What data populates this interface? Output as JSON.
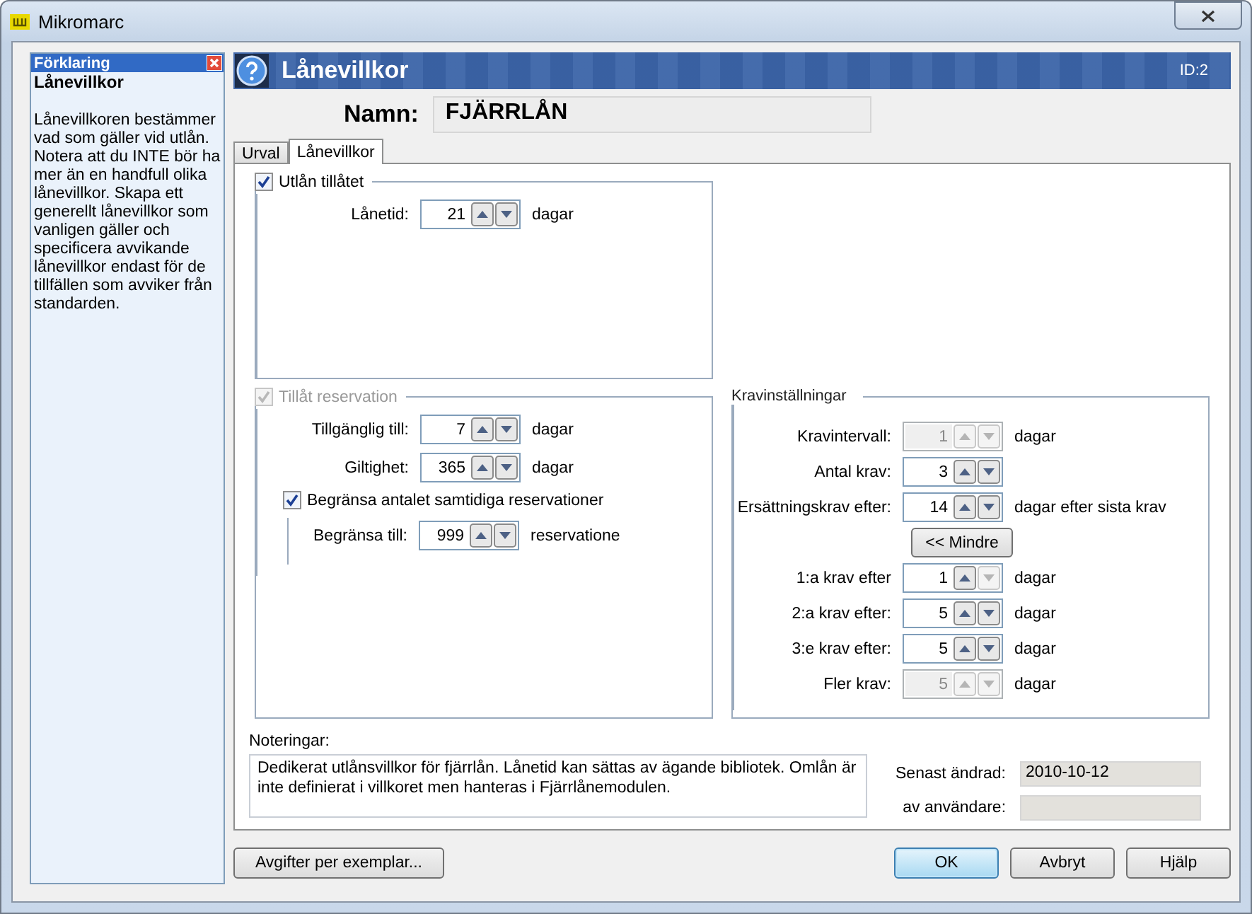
{
  "window": {
    "title": "Mikromarc"
  },
  "sidebar": {
    "title": "Förklaring",
    "heading": "Lånevillkor",
    "text": "Lånevillkoren bestämmer vad som gäller vid utlån. Notera att du INTE bör ha mer än en handfull olika lånevillkor. Skapa ett generellt lånevillkor som vanligen gäller och specificera avvikande lånevillkor endast för de tillfällen som avviker från standarden."
  },
  "header": {
    "title": "Lånevillkor",
    "id": "ID:2"
  },
  "name": {
    "label": "Namn:",
    "value": "FJÄRRLÅN"
  },
  "tabs": [
    {
      "label": "Urval",
      "selected": false
    },
    {
      "label": "Lånevillkor",
      "selected": true
    }
  ],
  "loan": {
    "label": "Utlån tillåtet",
    "checked": true,
    "disabled": false,
    "fields": [
      {
        "label": "Lånetid:",
        "value": "21",
        "unit": "dagar",
        "disabled": false
      }
    ]
  },
  "reservation": {
    "label": "Tillåt reservation",
    "checked": true,
    "disabled": true,
    "fields": [
      {
        "label": "Tillgänglig till:",
        "value": "7",
        "unit": "dagar",
        "disabled": false
      },
      {
        "label": "Giltighet:",
        "value": "365",
        "unit": "dagar",
        "disabled": false
      }
    ],
    "limit": {
      "label": "Begränsa antalet samtidiga reservationer",
      "checked": true,
      "field": {
        "label": "Begränsa till:",
        "value": "999",
        "unit": "reservatione",
        "disabled": false
      }
    }
  },
  "demands": {
    "title": "Kravinställningar",
    "rows": [
      {
        "kind": "spin",
        "label": "Kravintervall:",
        "value": "1",
        "unit": "dagar",
        "disabled": true
      },
      {
        "kind": "spin",
        "label": "Antal krav:",
        "value": "3",
        "disabled": false
      },
      {
        "kind": "spin",
        "label": "Ersättningskrav efter:",
        "value": "14",
        "unit": "dagar efter sista krav",
        "disabled": false
      },
      {
        "kind": "button",
        "label": "<< Mindre"
      },
      {
        "kind": "spin",
        "label": "1:a krav efter",
        "value": "1",
        "unit": "dagar",
        "disabled": false,
        "down_disabled": true
      },
      {
        "kind": "spin",
        "label": "2:a krav efter:",
        "value": "5",
        "unit": "dagar",
        "disabled": false
      },
      {
        "kind": "spin",
        "label": "3:e krav efter:",
        "value": "5",
        "unit": "dagar",
        "disabled": false
      },
      {
        "kind": "spin",
        "label": "Fler krav:",
        "value": "5",
        "unit": "dagar",
        "disabled": true
      }
    ]
  },
  "notes": {
    "label": "Noteringar:",
    "text": "Dedikerat utlånsvillkor för fjärrlån. Lånetid kan sättas av ägande bibliotek. Omlån är inte definierat i villkoret men hanteras i Fjärrlånemodulen."
  },
  "meta": [
    {
      "label": "Senast ändrad:",
      "value": "2010-10-12"
    },
    {
      "label": "av användare:"
    }
  ],
  "buttons": [
    {
      "label": "Avgifter per exemplar...",
      "default": false
    },
    {
      "label": "OK",
      "default": true
    },
    {
      "label": "Avbryt",
      "default": false
    },
    {
      "label": "Hjälp",
      "default": false
    }
  ]
}
